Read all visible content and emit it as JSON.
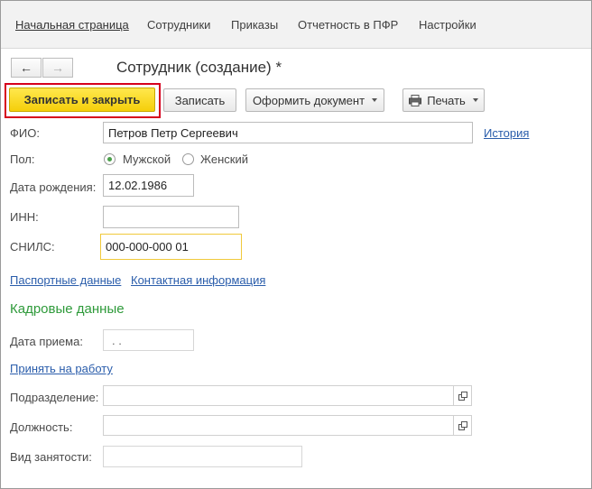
{
  "nav": {
    "items": [
      "Начальная страница",
      "Сотрудники",
      "Приказы",
      "Отчетность в ПФР",
      "Настройки"
    ]
  },
  "toolbar": {
    "back_icon": "←",
    "forward_icon": "→",
    "save_close": "Записать и закрыть",
    "save": "Записать",
    "make_doc": "Оформить документ",
    "print": "Печать"
  },
  "title": "Сотрудник (создание) *",
  "form": {
    "fio_label": "ФИО:",
    "fio_value": "Петров Петр Сергеевич",
    "history_link": "История",
    "gender_label": "Пол:",
    "gender_male": "Мужской",
    "gender_female": "Женский",
    "gender_selected": "Мужской",
    "birth_label": "Дата рождения:",
    "birth_value": "12.02.1986",
    "inn_label": "ИНН:",
    "inn_value": "",
    "snils_label": "СНИЛС:",
    "snils_value": "000-000-000 01",
    "passport_link": "Паспортные данные",
    "contact_link": "Контактная информация"
  },
  "hr": {
    "section_title": "Кадровые данные",
    "hire_date_label": "Дата приема:",
    "hire_date_value": " .  .",
    "hire_link": "Принять на работу",
    "department_label": "Подразделение:",
    "department_value": "",
    "position_label": "Должность:",
    "position_value": "",
    "employment_label": "Вид занятости:",
    "employment_value": ""
  },
  "colors": {
    "primary_button": "#f5cf0a",
    "highlight_border": "#d6001c",
    "link": "#2a5dab",
    "section_title": "#2e9a3a",
    "focused_border": "#f0c93b"
  }
}
